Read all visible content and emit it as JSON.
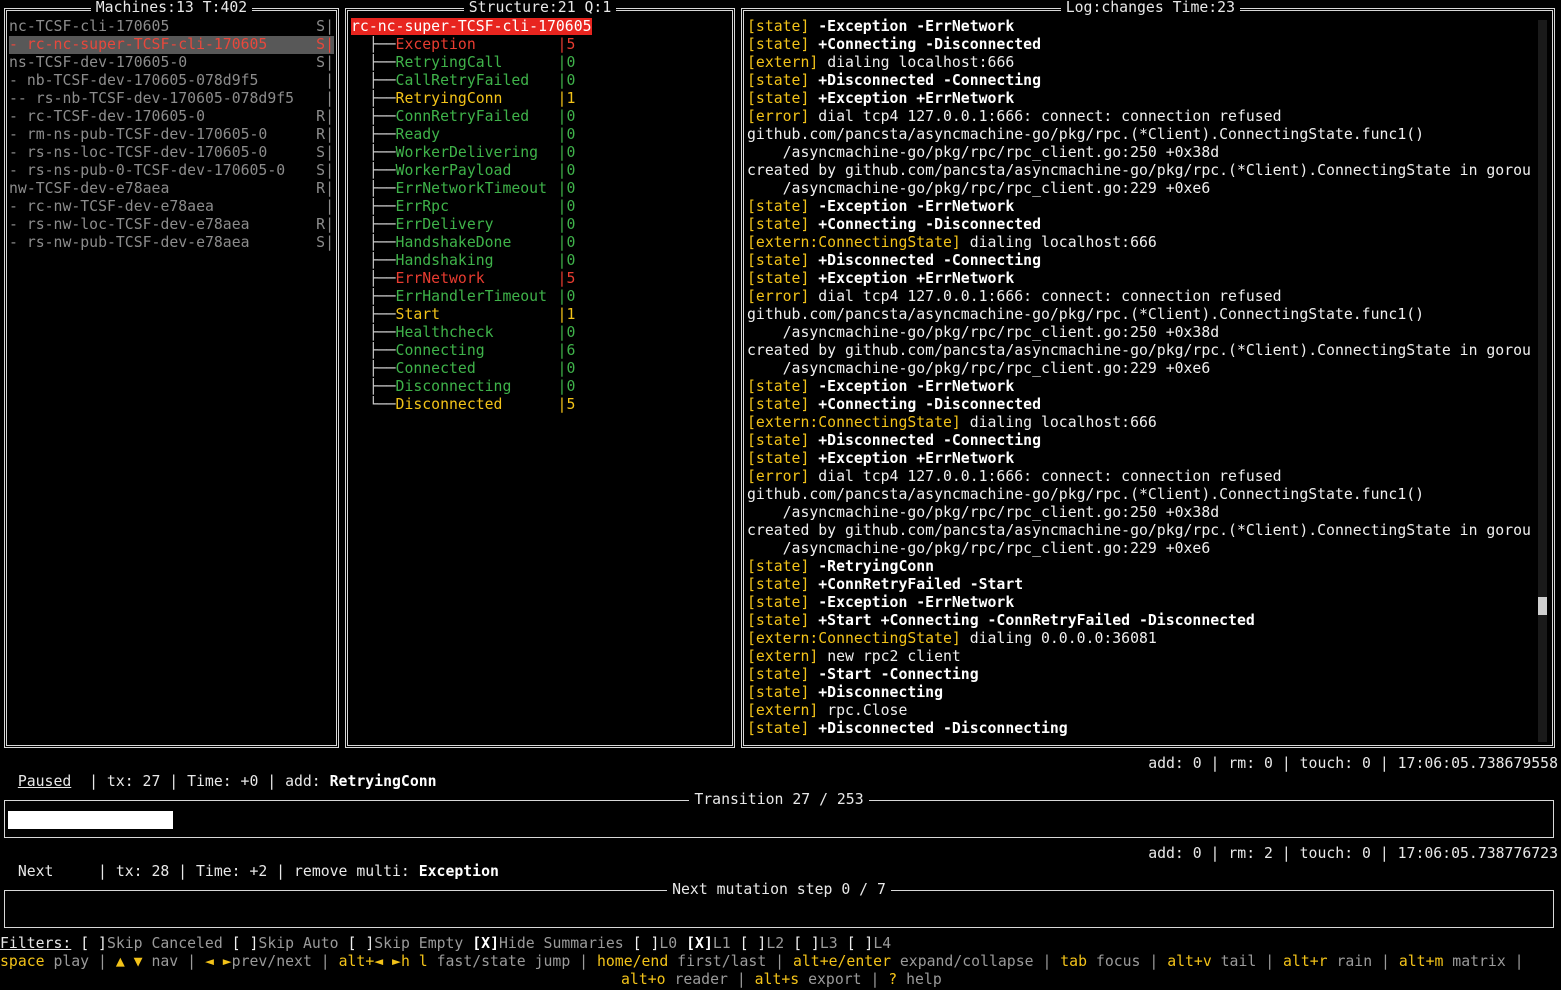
{
  "machines": {
    "title": "Machines:13 T:402",
    "items": [
      {
        "name": "nc-TCSF-cli-170605",
        "flag": "S|",
        "state": "normal"
      },
      {
        "name": "- rc-nc-super-TCSF-cli-170605",
        "flag": "S|",
        "state": "selected"
      },
      {
        "name": "ns-TCSF-dev-170605-0",
        "flag": "S|",
        "state": "normal"
      },
      {
        "name": "- nb-TCSF-dev-170605-078d9f5",
        "flag": "|",
        "state": "normal"
      },
      {
        "name": "-- rs-nb-TCSF-dev-170605-078d9f5",
        "flag": "|",
        "state": "normal"
      },
      {
        "name": "- rc-TCSF-dev-170605-0",
        "flag": "R|",
        "state": "normal"
      },
      {
        "name": "- rm-ns-pub-TCSF-dev-170605-0",
        "flag": "R|",
        "state": "normal"
      },
      {
        "name": "- rs-ns-loc-TCSF-dev-170605-0",
        "flag": "S|",
        "state": "normal"
      },
      {
        "name": "- rs-ns-pub-0-TCSF-dev-170605-0",
        "flag": "S|",
        "state": "normal"
      },
      {
        "name": "nw-TCSF-dev-e78aea",
        "flag": "R|",
        "state": "normal"
      },
      {
        "name": "- rc-nw-TCSF-dev-e78aea",
        "flag": "|",
        "state": "normal"
      },
      {
        "name": "- rs-nw-loc-TCSF-dev-e78aea",
        "flag": "R|",
        "state": "normal"
      },
      {
        "name": "- rs-nw-pub-TCSF-dev-e78aea",
        "flag": "S|",
        "state": "normal"
      }
    ]
  },
  "structure": {
    "title": "Structure:21 Q:1",
    "root": "rc-nc-super-TCSF-cli-170605",
    "states": [
      {
        "name": "Exception",
        "count": "|5",
        "color": "red"
      },
      {
        "name": "RetryingCall",
        "count": "|0",
        "color": "green"
      },
      {
        "name": "CallRetryFailed",
        "count": "|0",
        "color": "green"
      },
      {
        "name": "RetryingConn",
        "count": "|1",
        "color": "yellow"
      },
      {
        "name": "ConnRetryFailed",
        "count": "|0",
        "color": "green"
      },
      {
        "name": "Ready",
        "count": "|0",
        "color": "green"
      },
      {
        "name": "WorkerDelivering",
        "count": "|0",
        "color": "green"
      },
      {
        "name": "WorkerPayload",
        "count": "|0",
        "color": "green"
      },
      {
        "name": "ErrNetworkTimeout",
        "count": "|0",
        "color": "green"
      },
      {
        "name": "ErrRpc",
        "count": "|0",
        "color": "green"
      },
      {
        "name": "ErrDelivery",
        "count": "|0",
        "color": "green"
      },
      {
        "name": "HandshakeDone",
        "count": "|0",
        "color": "green"
      },
      {
        "name": "Handshaking",
        "count": "|0",
        "color": "green"
      },
      {
        "name": "ErrNetwork",
        "count": "|5",
        "color": "red"
      },
      {
        "name": "ErrHandlerTimeout",
        "count": "|0",
        "color": "green"
      },
      {
        "name": "Start",
        "count": "|1",
        "color": "yellow"
      },
      {
        "name": "Healthcheck",
        "count": "|0",
        "color": "green"
      },
      {
        "name": "Connecting",
        "count": "|6",
        "color": "green"
      },
      {
        "name": "Connected",
        "count": "|0",
        "color": "green"
      },
      {
        "name": "Disconnecting",
        "count": "|0",
        "color": "green"
      },
      {
        "name": "Disconnected",
        "count": "|5",
        "color": "yellow"
      }
    ]
  },
  "log": {
    "title": "Log:changes Time:23",
    "scroll_fraction": 0.82,
    "lines": [
      {
        "tag": "[state]",
        "text": " -Exception -ErrNetwork",
        "bold": true
      },
      {
        "tag": "[state]",
        "text": " +Connecting -Disconnected",
        "bold": true
      },
      {
        "tag": "[extern]",
        "text": " dialing localhost:666",
        "bold": false
      },
      {
        "tag": "[state]",
        "text": " +Disconnected -Connecting",
        "bold": true
      },
      {
        "tag": "[state]",
        "text": " +Exception +ErrNetwork",
        "bold": true
      },
      {
        "tag": "[error]",
        "text": " dial tcp4 127.0.0.1:666: connect: connection refused",
        "bold": false
      },
      {
        "tag": "",
        "text": "github.com/pancsta/asyncmachine-go/pkg/rpc.(*Client).ConnectingState.func1()",
        "bold": false
      },
      {
        "tag": "",
        "text": "    /asyncmachine-go/pkg/rpc/rpc_client.go:250 +0x38d",
        "bold": false
      },
      {
        "tag": "",
        "text": "created by github.com/pancsta/asyncmachine-go/pkg/rpc.(*Client).ConnectingState in gorou",
        "bold": false
      },
      {
        "tag": "",
        "text": "    /asyncmachine-go/pkg/rpc/rpc_client.go:229 +0xe6",
        "bold": false
      },
      {
        "tag": "[state]",
        "text": " -Exception -ErrNetwork",
        "bold": true
      },
      {
        "tag": "[state]",
        "text": " +Connecting -Disconnected",
        "bold": true
      },
      {
        "tag": "[extern:ConnectingState]",
        "text": " dialing localhost:666",
        "bold": false
      },
      {
        "tag": "[state]",
        "text": " +Disconnected -Connecting",
        "bold": true
      },
      {
        "tag": "[state]",
        "text": " +Exception +ErrNetwork",
        "bold": true
      },
      {
        "tag": "[error]",
        "text": " dial tcp4 127.0.0.1:666: connect: connection refused",
        "bold": false
      },
      {
        "tag": "",
        "text": "github.com/pancsta/asyncmachine-go/pkg/rpc.(*Client).ConnectingState.func1()",
        "bold": false
      },
      {
        "tag": "",
        "text": "    /asyncmachine-go/pkg/rpc/rpc_client.go:250 +0x38d",
        "bold": false
      },
      {
        "tag": "",
        "text": "created by github.com/pancsta/asyncmachine-go/pkg/rpc.(*Client).ConnectingState in gorou",
        "bold": false
      },
      {
        "tag": "",
        "text": "    /asyncmachine-go/pkg/rpc/rpc_client.go:229 +0xe6",
        "bold": false
      },
      {
        "tag": "[state]",
        "text": " -Exception -ErrNetwork",
        "bold": true
      },
      {
        "tag": "[state]",
        "text": " +Connecting -Disconnected",
        "bold": true
      },
      {
        "tag": "[extern:ConnectingState]",
        "text": " dialing localhost:666",
        "bold": false
      },
      {
        "tag": "[state]",
        "text": " +Disconnected -Connecting",
        "bold": true
      },
      {
        "tag": "[state]",
        "text": " +Exception +ErrNetwork",
        "bold": true
      },
      {
        "tag": "[error]",
        "text": " dial tcp4 127.0.0.1:666: connect: connection refused",
        "bold": false
      },
      {
        "tag": "",
        "text": "github.com/pancsta/asyncmachine-go/pkg/rpc.(*Client).ConnectingState.func1()",
        "bold": false
      },
      {
        "tag": "",
        "text": "    /asyncmachine-go/pkg/rpc/rpc_client.go:250 +0x38d",
        "bold": false
      },
      {
        "tag": "",
        "text": "created by github.com/pancsta/asyncmachine-go/pkg/rpc.(*Client).ConnectingState in gorou",
        "bold": false
      },
      {
        "tag": "",
        "text": "    /asyncmachine-go/pkg/rpc/rpc_client.go:229 +0xe6",
        "bold": false
      },
      {
        "tag": "[state]",
        "text": " -RetryingConn",
        "bold": true
      },
      {
        "tag": "[state]",
        "text": " +ConnRetryFailed -Start",
        "bold": true
      },
      {
        "tag": "[state]",
        "text": " -Exception -ErrNetwork",
        "bold": true
      },
      {
        "tag": "[state]",
        "text": " +Start +Connecting -ConnRetryFailed -Disconnected",
        "bold": true
      },
      {
        "tag": "[extern:ConnectingState]",
        "text": " dialing 0.0.0.0:36081",
        "bold": false
      },
      {
        "tag": "[extern]",
        "text": " new rpc2 client",
        "bold": false
      },
      {
        "tag": "[state]",
        "text": " -Start -Connecting",
        "bold": true
      },
      {
        "tag": "[state]",
        "text": " +Disconnecting",
        "bold": true
      },
      {
        "tag": "[extern]",
        "text": " rpc.Close",
        "bold": false
      },
      {
        "tag": "[state]",
        "text": " +Disconnected -Disconnecting",
        "bold": true
      }
    ]
  },
  "status_current": {
    "mode": "Paused",
    "info": "  | tx: 27 | Time: +0 | add: ",
    "state": "RetryingConn",
    "right": "add: 0 | rm: 0 | touch: 0 | 17:06:05.738679558"
  },
  "transition": {
    "title": "Transition 27 / 253",
    "progress": 0.107
  },
  "status_next": {
    "mode": "Next",
    "info": "     | tx: 28 | Time: +2 | remove multi: ",
    "state": "Exception",
    "right": "add: 0 | rm: 2 | touch: 0 | 17:06:05.738776723"
  },
  "mutation": {
    "title": "Next mutation step 0 / 7"
  },
  "filters": {
    "label": "Filters:",
    "items": [
      {
        "box": "[ ]",
        "text": "Skip Canceled"
      },
      {
        "box": "[ ]",
        "text": "Skip Auto"
      },
      {
        "box": "[ ]",
        "text": "Skip Empty"
      },
      {
        "box": "[X]",
        "text": "Hide Summaries"
      },
      {
        "box": "[ ]",
        "text": "L0"
      },
      {
        "box": "[X]",
        "text": "L1"
      },
      {
        "box": "[ ]",
        "text": "L2"
      },
      {
        "box": "[ ]",
        "text": "L3"
      },
      {
        "box": "[ ]",
        "text": "L4"
      }
    ]
  },
  "shortcuts": {
    "line1": [
      {
        "key": "space",
        "desc": " play"
      },
      {
        "key": "▲ ▼",
        "desc": " nav"
      },
      {
        "key": "◄ ►",
        "desc": "prev/next"
      },
      {
        "key": "alt+◄ ►h l",
        "desc": " fast/state jump"
      },
      {
        "key": "home/end",
        "desc": " first/last"
      },
      {
        "key": "alt+e/enter",
        "desc": " expand/collapse"
      },
      {
        "key": "tab",
        "desc": " focus"
      },
      {
        "key": "alt+v",
        "desc": " tail"
      },
      {
        "key": "alt+r",
        "desc": " rain"
      },
      {
        "key": "alt+m",
        "desc": " matrix"
      }
    ],
    "line2": [
      {
        "key": "alt+o",
        "desc": " reader"
      },
      {
        "key": "alt+s",
        "desc": " export"
      },
      {
        "key": "?",
        "desc": " help"
      }
    ]
  },
  "colors": {
    "yellow": "#f3c319",
    "red": "#e83c30",
    "green": "#3fb34a",
    "selection_bg": "#585858",
    "root_bg": "#e8251f"
  }
}
